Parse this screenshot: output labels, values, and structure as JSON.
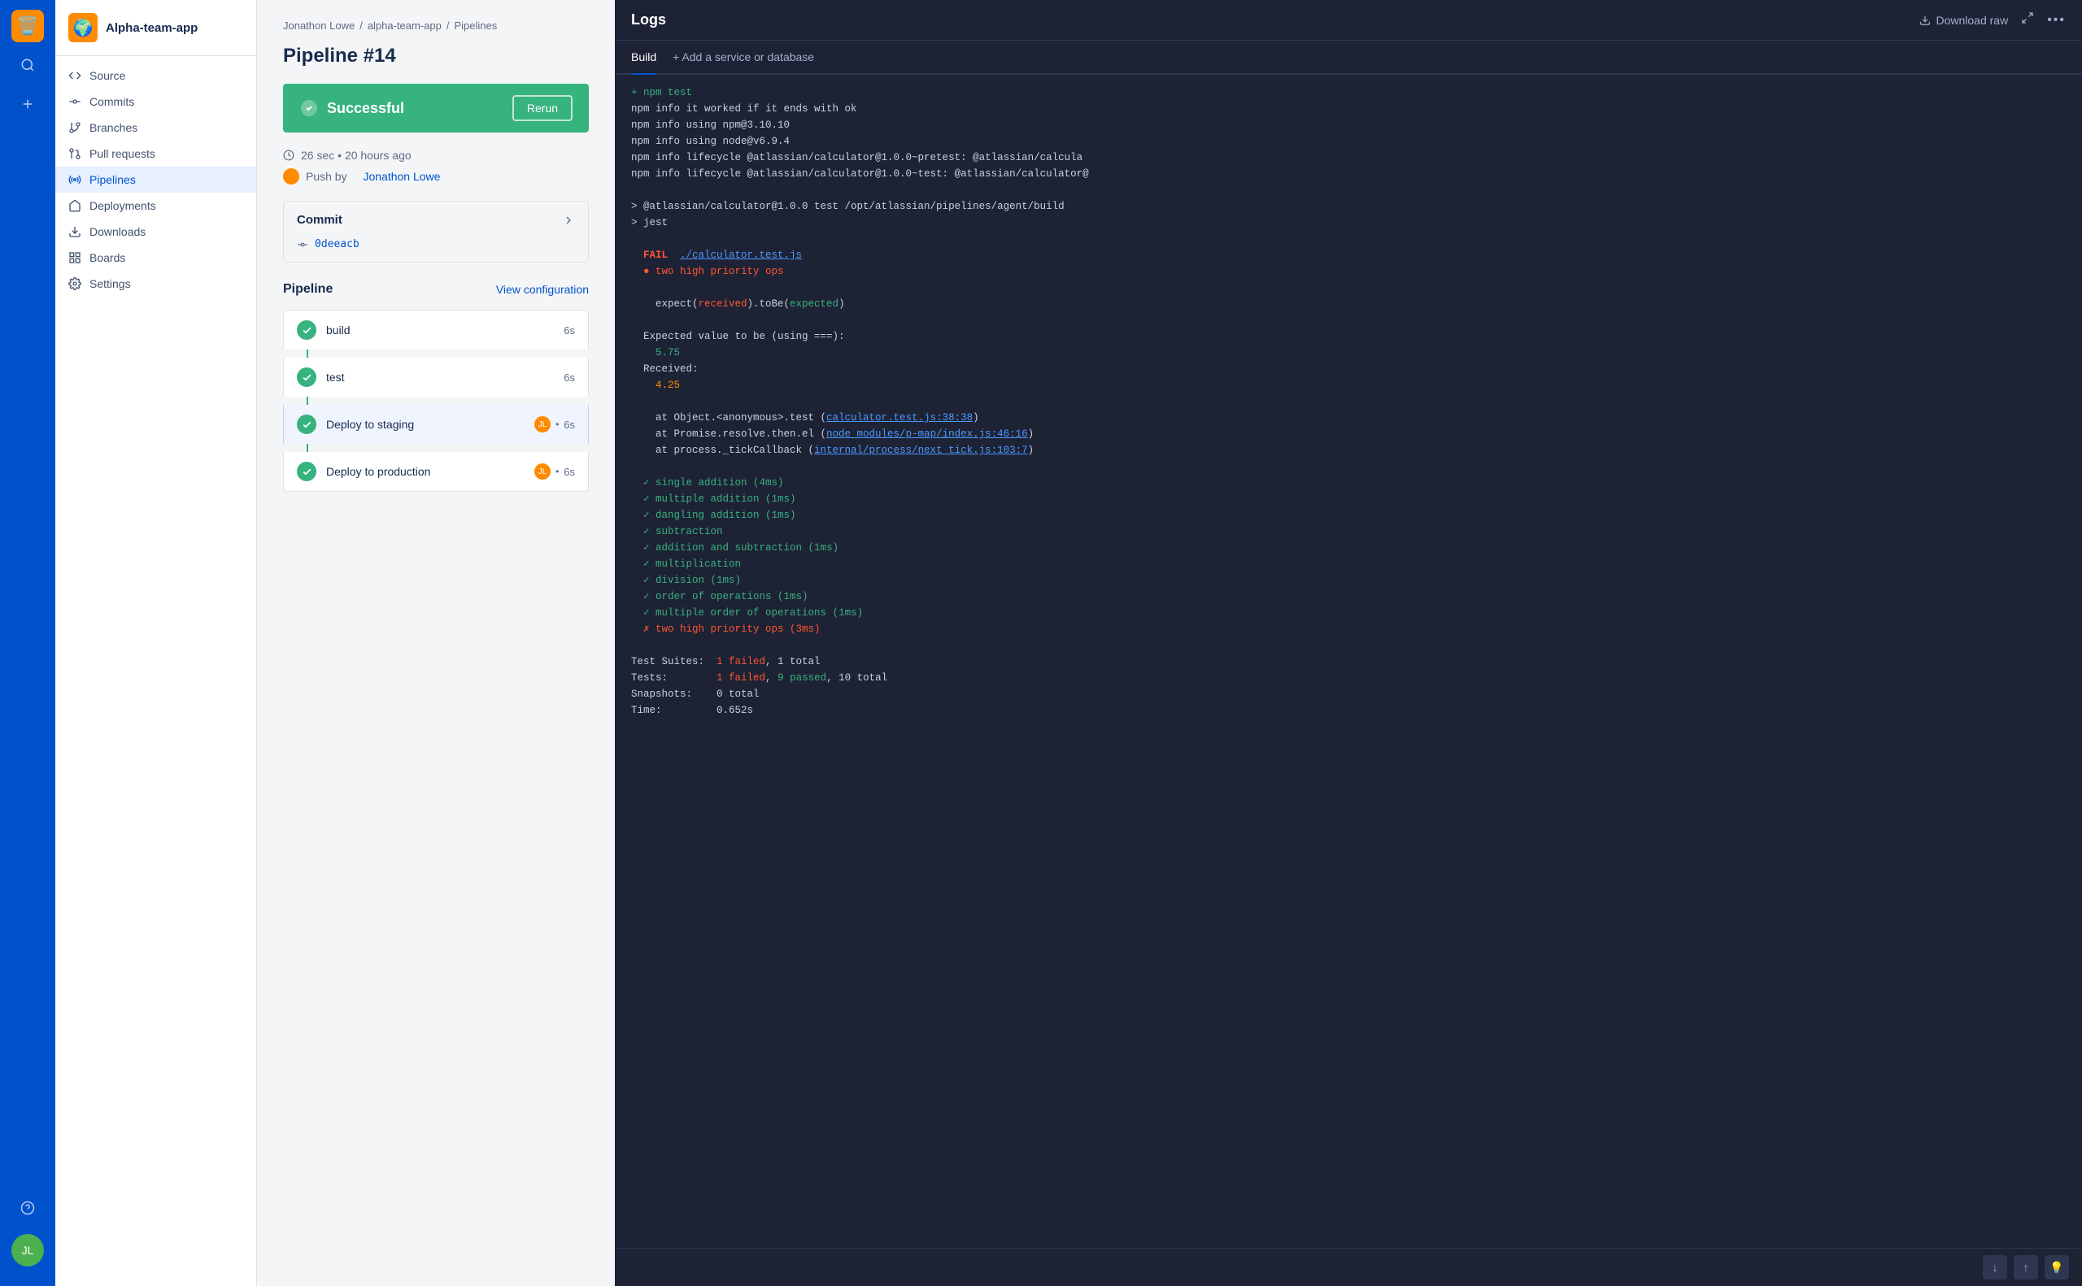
{
  "iconBar": {
    "appEmoji": "🗑️",
    "searchLabel": "search",
    "addLabel": "add",
    "helpLabel": "help",
    "userLabel": "user-avatar"
  },
  "sidebar": {
    "appName": "Alpha-team-app",
    "navItems": [
      {
        "id": "source",
        "label": "Source",
        "icon": "code"
      },
      {
        "id": "commits",
        "label": "Commits",
        "icon": "branch"
      },
      {
        "id": "branches",
        "label": "Branches",
        "icon": "fork"
      },
      {
        "id": "pull-requests",
        "label": "Pull requests",
        "icon": "pr"
      },
      {
        "id": "pipelines",
        "label": "Pipelines",
        "icon": "pipeline",
        "active": true
      },
      {
        "id": "deployments",
        "label": "Deployments",
        "icon": "deploy"
      },
      {
        "id": "downloads",
        "label": "Downloads",
        "icon": "download"
      },
      {
        "id": "boards",
        "label": "Boards",
        "icon": "board"
      },
      {
        "id": "settings",
        "label": "Settings",
        "icon": "settings"
      }
    ]
  },
  "breadcrumb": {
    "parts": [
      "Jonathon Lowe",
      "alpha-team-app",
      "Pipelines"
    ]
  },
  "pipeline": {
    "title": "Pipeline #14",
    "status": "Successful",
    "rerunLabel": "Rerun",
    "duration": "26 sec",
    "timeAgo": "20 hours ago",
    "pushBy": "Push by",
    "pusher": "Jonathon Lowe",
    "commitLabel": "Commit",
    "commitHash": "0deeacb",
    "pipelineLabel": "Pipeline",
    "viewConfigLabel": "View configuration",
    "steps": [
      {
        "name": "build",
        "time": "6s",
        "hasAvatar": false
      },
      {
        "name": "test",
        "time": "6s",
        "hasAvatar": false
      },
      {
        "name": "Deploy to staging",
        "time": "6s",
        "hasAvatar": true,
        "active": true
      },
      {
        "name": "Deploy to production",
        "time": "6s",
        "hasAvatar": true
      }
    ]
  },
  "logs": {
    "title": "Logs",
    "downloadRawLabel": "Download raw",
    "buildTab": "Build",
    "addServiceLabel": "+ Add a service or database",
    "content": [
      {
        "type": "plain",
        "text": "+ npm test"
      },
      {
        "type": "plain",
        "text": "npm info it worked if it ends with ok"
      },
      {
        "type": "plain",
        "text": "npm info using npm@3.10.10"
      },
      {
        "type": "plain",
        "text": "npm info using node@v6.9.4"
      },
      {
        "type": "plain",
        "text": "npm info lifecycle @atlassian/calculator@1.0.0~pretest: @atlassian/calcula"
      },
      {
        "type": "plain",
        "text": "npm info lifecycle @atlassian/calculator@1.0.0~test: @atlassian/calculator"
      },
      {
        "type": "blank"
      },
      {
        "type": "plain",
        "text": "> @atlassian/calculator@1.0.0 test /opt/atlassian/pipelines/agent/build"
      },
      {
        "type": "plain",
        "text": "> jest"
      },
      {
        "type": "blank"
      },
      {
        "type": "fail-line",
        "prefix": "FAIL  ",
        "link": "./calculator.test.js"
      },
      {
        "type": "bullet-red",
        "text": "two high priority ops"
      },
      {
        "type": "blank"
      },
      {
        "type": "expect-line",
        "text": "  expect(received).toBe(expected)"
      },
      {
        "type": "blank"
      },
      {
        "type": "plain",
        "text": "  Expected value to be (using ===):"
      },
      {
        "type": "value-green",
        "text": "    5.75"
      },
      {
        "type": "plain",
        "text": "  Received:"
      },
      {
        "type": "value-orange",
        "text": "    4.25"
      },
      {
        "type": "blank"
      },
      {
        "type": "trace",
        "prefix": "  at Object.<anonymous>.test (",
        "link": "calculator.test.js:38:38",
        "suffix": ")"
      },
      {
        "type": "trace",
        "prefix": "  at Promise.resolve.then.el (",
        "link": "node_modules/p-map/index.js:46:16",
        "suffix": ")"
      },
      {
        "type": "trace",
        "prefix": "  at process._tickCallback (",
        "link": "internal/process/next_tick.js:103:7",
        "suffix": ")"
      },
      {
        "type": "blank"
      },
      {
        "type": "check",
        "text": "✓ single addition (4ms)"
      },
      {
        "type": "check",
        "text": "✓ multiple addition (1ms)"
      },
      {
        "type": "check",
        "text": "✓ dangling addition (1ms)"
      },
      {
        "type": "check",
        "text": "✓ subtraction"
      },
      {
        "type": "check",
        "text": "✓ addition and subtraction (1ms)"
      },
      {
        "type": "check",
        "text": "✓ multiplication"
      },
      {
        "type": "check",
        "text": "✓ division (1ms)"
      },
      {
        "type": "check",
        "text": "✓ order of operations (1ms)"
      },
      {
        "type": "check",
        "text": "✓ multiple order of operations (1ms)"
      },
      {
        "type": "cross",
        "text": "✗ two high priority ops (3ms)"
      },
      {
        "type": "blank"
      },
      {
        "type": "suite-result",
        "label": "Test Suites:",
        "fail": "1 failed",
        "sep": ", ",
        "pass": "1 total"
      },
      {
        "type": "test-result",
        "label": "Tests:",
        "fail": "1 failed",
        "sep": ", ",
        "pass": "9 passed",
        "total": ", 10 total"
      },
      {
        "type": "plain",
        "text": "Snapshots:   0 total"
      },
      {
        "type": "plain",
        "text": "Time:        0.652s"
      }
    ]
  }
}
